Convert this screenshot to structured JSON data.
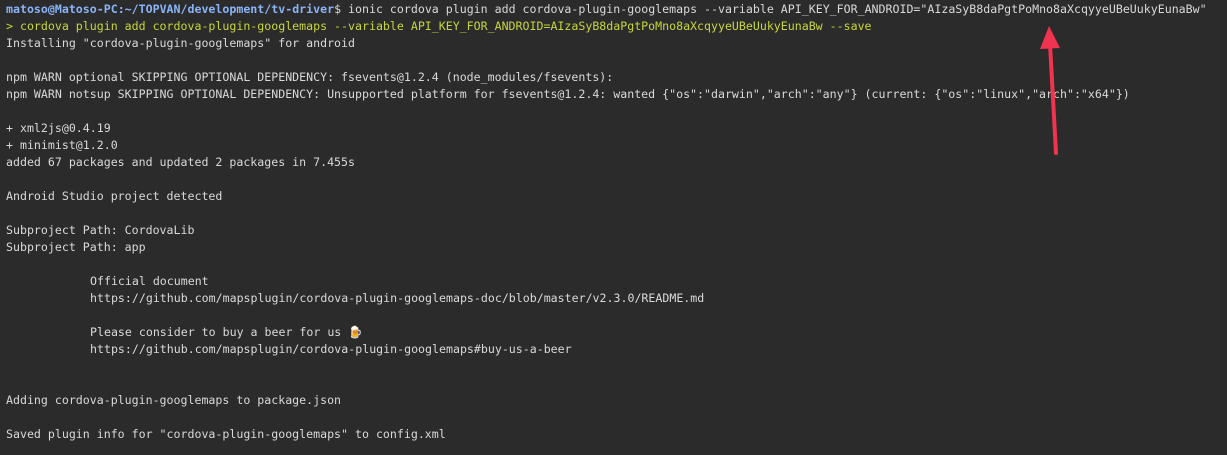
{
  "terminal": {
    "prompt": {
      "user_host": "matoso@Matoso-PC",
      "sep": ":",
      "path": "~/TOPVAN/development/tv-driver",
      "symbol": "$ ",
      "command": "ionic cordova plugin add cordova-plugin-googlemaps --variable API_KEY_FOR_ANDROID=\"AIzaSyB8daPgtPoMno8aXcqyyeUBeUukyEunaBw\""
    },
    "echo": "> cordova plugin add cordova-plugin-googlemaps --variable API_KEY_FOR_ANDROID=AIzaSyB8daPgtPoMno8aXcqyyeUBeUukyEunaBw --save",
    "lines": {
      "installing": "Installing \"cordova-plugin-googlemaps\" for android",
      "warn_optional": "npm WARN optional SKIPPING OPTIONAL DEPENDENCY: fsevents@1.2.4 (node_modules/fsevents):",
      "warn_notsup": "npm WARN notsup SKIPPING OPTIONAL DEPENDENCY: Unsupported platform for fsevents@1.2.4: wanted {\"os\":\"darwin\",\"arch\":\"any\"} (current: {\"os\":\"linux\",\"arch\":\"x64\"})",
      "pkg_xml2js": "+ xml2js@0.4.19",
      "pkg_minimist": "+ minimist@1.2.0",
      "added": "added 67 packages and updated 2 packages in 7.455s",
      "studio": "Android Studio project detected",
      "subproject_1": "Subproject Path: CordovaLib",
      "subproject_2": "Subproject Path: app",
      "official_doc": "Official document",
      "doc_url": "https://github.com/mapsplugin/cordova-plugin-googlemaps-doc/blob/master/v2.3.0/README.md",
      "beer": "Please consider to buy a beer for us 🍺",
      "beer_url": "https://github.com/mapsplugin/cordova-plugin-googlemaps#buy-us-a-beer",
      "adding": "Adding cordova-plugin-googlemaps to package.json",
      "saved": "Saved plugin info for \"cordova-plugin-googlemaps\" to config.xml"
    }
  },
  "colors": {
    "background": "#2b2b2b",
    "prompt": "#8ab4f8",
    "echo": "#c7d63a",
    "text": "#d9d9d9",
    "annotation_arrow": "#f0334f"
  },
  "annotation": {
    "icon": "arrow-up-icon"
  }
}
